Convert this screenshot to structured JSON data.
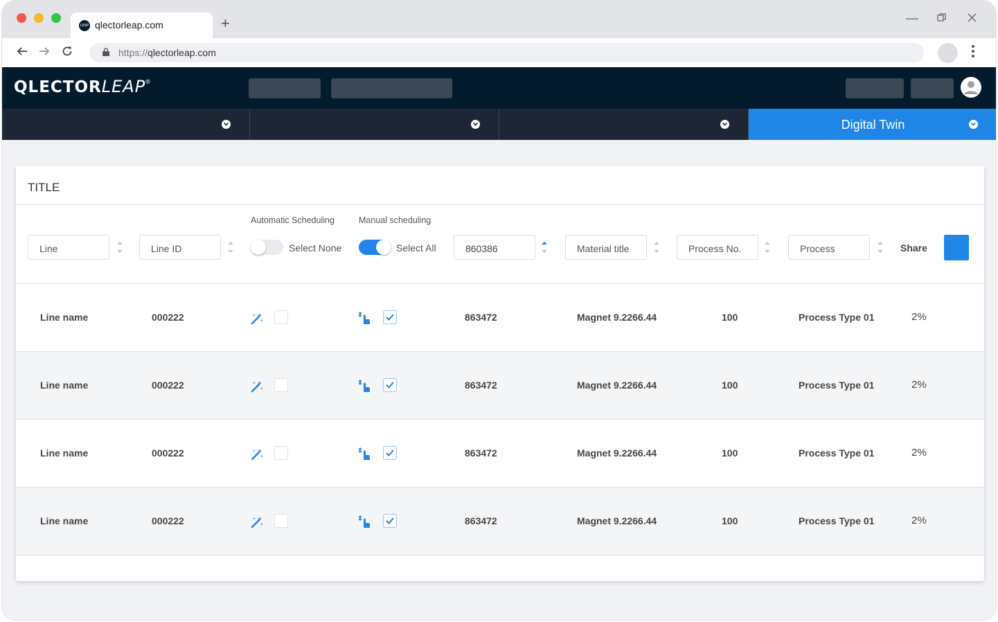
{
  "browser": {
    "tab_title": "qlectorleap.com",
    "favicon_text": "LEAP",
    "url_protocol": "https://",
    "url_host": "qlectorleap.com"
  },
  "app": {
    "logo_bold": "QLECTOR",
    "logo_italic": "LEAP",
    "logo_mark": "®"
  },
  "section_nav": {
    "active_label": "Digital Twin"
  },
  "card": {
    "title": "TITLE"
  },
  "filters": {
    "line_placeholder": "Line",
    "line_id_placeholder": "Line ID",
    "automatic_label": "Automatic Scheduling",
    "automatic_toggle_label": "Select None",
    "automatic_toggle_on": false,
    "manual_label": "Manual scheduling",
    "manual_toggle_label": "Select All",
    "manual_toggle_on": true,
    "order_value": "860386",
    "material_placeholder": "Material title",
    "process_no_placeholder": "Process No.",
    "process_placeholder": "Process",
    "share_label": "Share"
  },
  "rows": [
    {
      "line": "Line name",
      "line_id": "000222",
      "auto_checked": false,
      "manual_checked": true,
      "order": "863472",
      "material": "Magnet 9.2266.44",
      "process_no": "100",
      "process": "Process Type 01",
      "share": "2%"
    },
    {
      "line": "Line name",
      "line_id": "000222",
      "auto_checked": false,
      "manual_checked": true,
      "order": "863472",
      "material": "Magnet 9.2266.44",
      "process_no": "100",
      "process": "Process Type 01",
      "share": "2%"
    },
    {
      "line": "Line name",
      "line_id": "000222",
      "auto_checked": false,
      "manual_checked": true,
      "order": "863472",
      "material": "Magnet 9.2266.44",
      "process_no": "100",
      "process": "Process Type 01",
      "share": "2%"
    },
    {
      "line": "Line name",
      "line_id": "000222",
      "auto_checked": false,
      "manual_checked": true,
      "order": "863472",
      "material": "Magnet 9.2266.44",
      "process_no": "100",
      "process": "Process Type 01",
      "share": "2%"
    }
  ],
  "colors": {
    "header_bg": "#041b2d",
    "nav_bg": "#1c2635",
    "accent": "#1f86e8"
  }
}
